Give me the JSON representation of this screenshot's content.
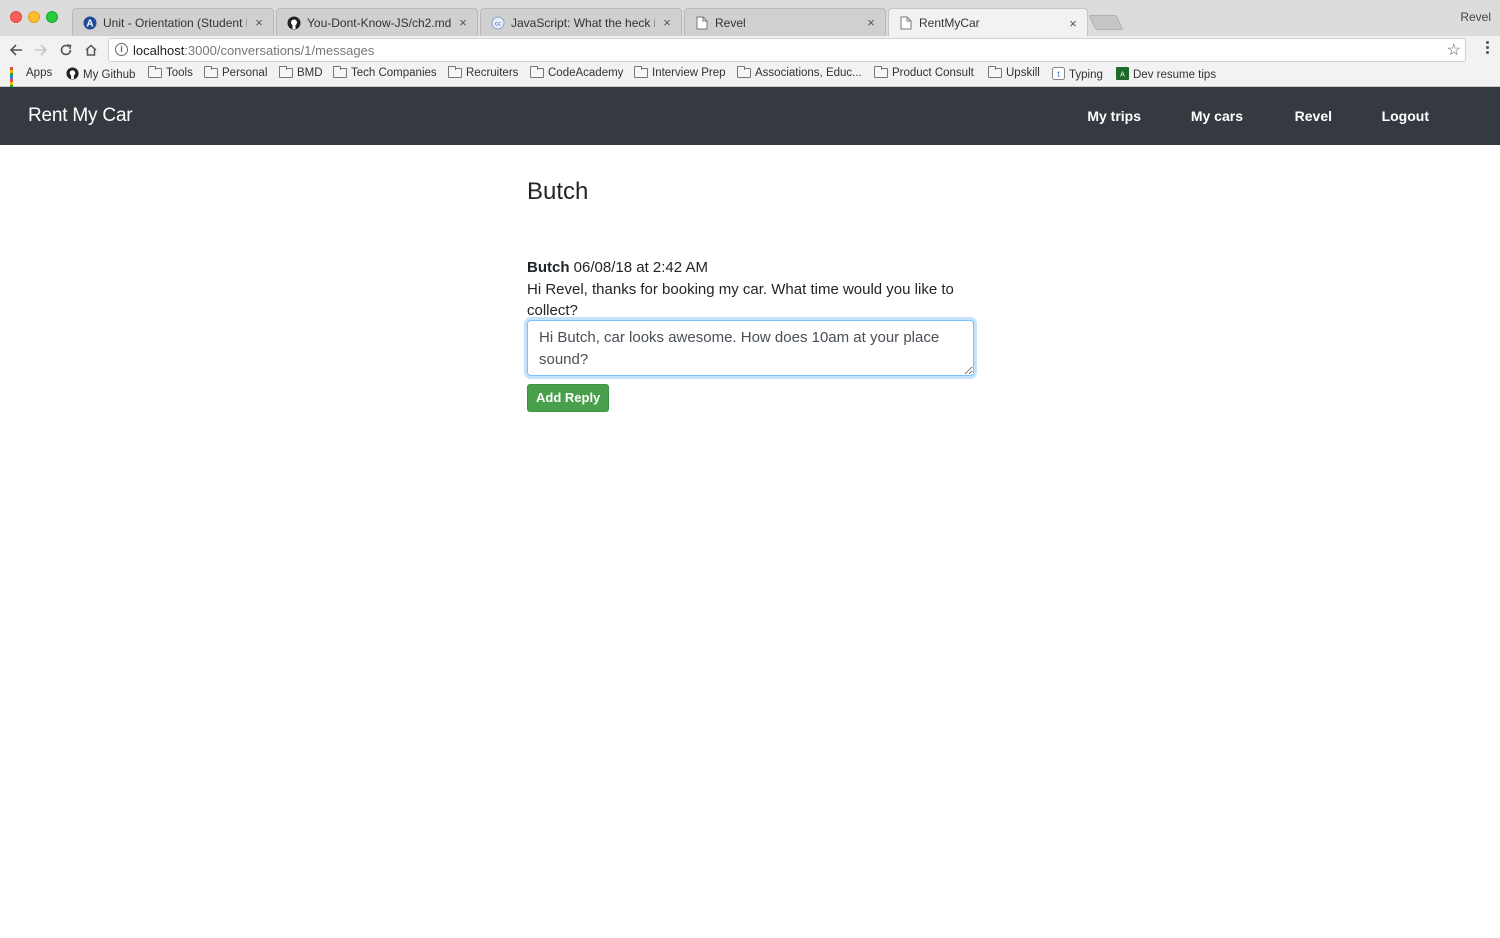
{
  "browser": {
    "profile_name": "Revel",
    "tabs": [
      {
        "title": "Unit - Orientation (Student Ha",
        "icon": "codeacademy-a-icon"
      },
      {
        "title": "You-Dont-Know-JS/ch2.md at",
        "icon": "github-icon"
      },
      {
        "title": "JavaScript: What the heck is a",
        "icon": "site-icon"
      },
      {
        "title": "Revel",
        "icon": "page-icon"
      },
      {
        "title": "RentMyCar",
        "icon": "page-icon",
        "active": true
      }
    ],
    "address": {
      "host": "localhost",
      "path": ":3000/conversations/1/messages"
    },
    "bookmarks": [
      {
        "label": "Apps",
        "icon": "apps-grid-icon"
      },
      {
        "label": "My Github",
        "icon": "github-icon"
      },
      {
        "label": "Tools",
        "icon": "folder-icon"
      },
      {
        "label": "Personal",
        "icon": "folder-icon"
      },
      {
        "label": "BMD",
        "icon": "folder-icon"
      },
      {
        "label": "Tech Companies",
        "icon": "folder-icon"
      },
      {
        "label": "Recruiters",
        "icon": "folder-icon"
      },
      {
        "label": "CodeAcademy",
        "icon": "folder-icon"
      },
      {
        "label": "Interview Prep",
        "icon": "folder-icon"
      },
      {
        "label": "Associations, Educ...",
        "icon": "folder-icon"
      },
      {
        "label": "Product Consult",
        "icon": "folder-icon"
      },
      {
        "label": "Upskill",
        "icon": "folder-icon"
      },
      {
        "label": "Typing",
        "icon": "typing-icon"
      },
      {
        "label": "Dev resume tips",
        "icon": "bookmark-site-icon"
      }
    ]
  },
  "app": {
    "brand": "Rent My Car",
    "nav": [
      {
        "label": "My trips"
      },
      {
        "label": "My cars"
      },
      {
        "label": "Revel"
      },
      {
        "label": "Logout"
      }
    ],
    "colors": {
      "navbar": "#343a40",
      "button": "#48a04c",
      "focus": "#80bdff"
    }
  },
  "conversation": {
    "title": "Butch",
    "messages": [
      {
        "author": "Butch",
        "timestamp": "06/08/18 at 2:42 AM",
        "body": "Hi Revel, thanks for booking my car. What time would you like to collect?"
      }
    ],
    "reply_value": "Hi Butch, car looks awesome. How does 10am at your place sound?",
    "reply_button": "Add Reply"
  }
}
